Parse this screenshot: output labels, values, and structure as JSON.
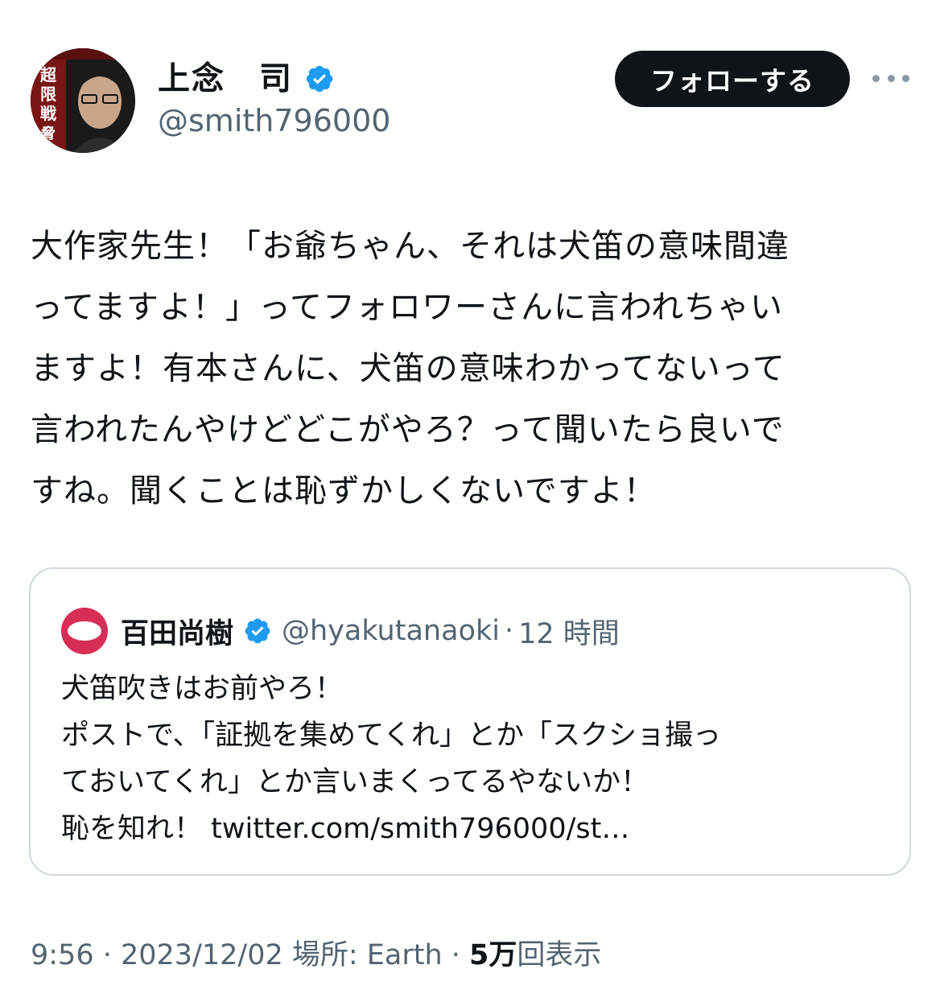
{
  "author": {
    "name": "上念　司",
    "handle": "@smith796000",
    "avatar_text": "「超限戦」の脅威"
  },
  "actions": {
    "follow_label": "フォローする",
    "more_icon": "more-dots-icon"
  },
  "tweet": {
    "text": "大作家先生！「お爺ちゃん、それは犬笛の意味間違\nってますよ！」ってフォロワーさんに言われちゃい\nますよ！有本さんに、犬笛の意味わかってないって\n言われたんやけどどこがやろ？って聞いたら良いで\nすね。聞くことは恥ずかしくないですよ！"
  },
  "quoted": {
    "name": "百田尚樹",
    "handle": "@hyakutanaoki",
    "separator": "·",
    "time": "12 時間",
    "text": "犬笛吹きはお前やろ！\nポストで、「証拠を集めてくれ」とか「スクショ撮っ\nておいてくれ」とか言いまくってるやないか！\n恥を知れ！ twitter.com/smith796000/st…"
  },
  "meta": {
    "time": "9:56",
    "sep1": " · ",
    "date": "2023/12/02",
    "location": " 場所: Earth",
    "sep2": " · ",
    "views_count": "5万",
    "views_label": "回表示"
  },
  "colors": {
    "verified": "#1d9bf0",
    "text_primary": "#0f1419",
    "text_secondary": "#536471",
    "border": "#cfd9de",
    "quoted_avatar": "#d62e56"
  }
}
